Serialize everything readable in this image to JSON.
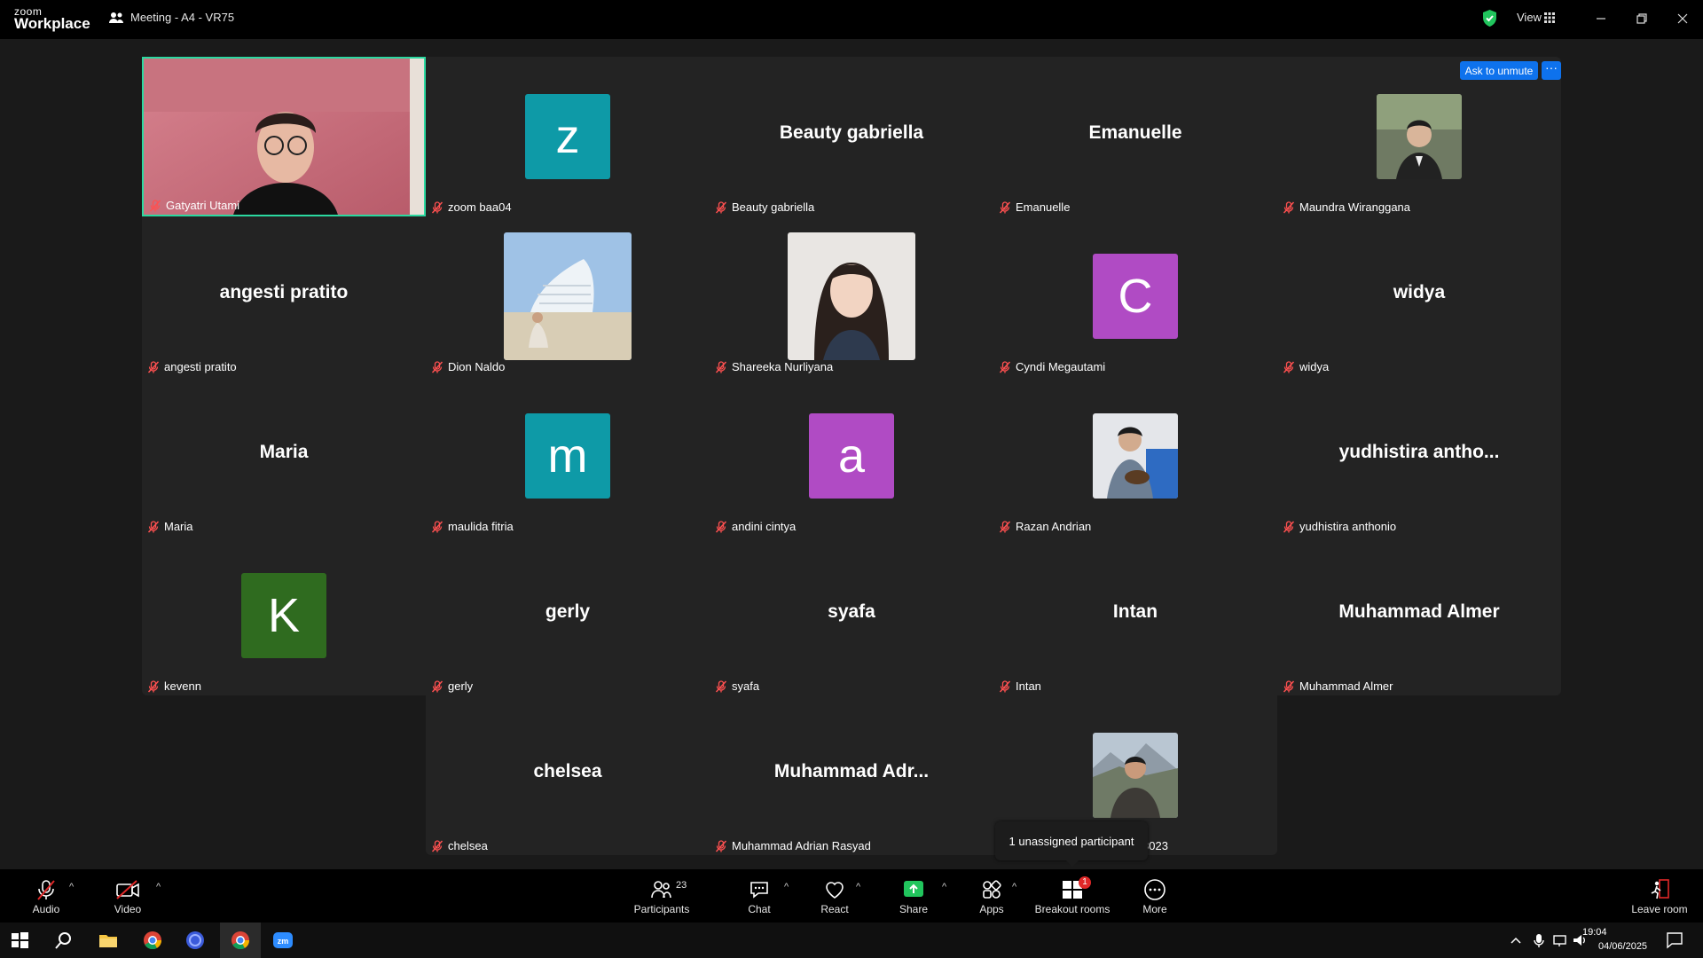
{
  "app": {
    "logo_top": "zoom",
    "logo_bottom": "Workplace",
    "meeting_title": "Meeting - A4 - VR75",
    "view_label": "View"
  },
  "actions": {
    "ask_to_unmute": "Ask to unmute",
    "more_dots": "···"
  },
  "tiles": [
    {
      "name": "Gatyatri Utami"
    },
    {
      "name": "zoom baa04",
      "initial": "z",
      "color": "#0e9aa7"
    },
    {
      "name": "Beauty gabriella",
      "big": "Beauty gabriella"
    },
    {
      "name": "Emanuelle",
      "big": "Emanuelle"
    },
    {
      "name": "Maundra Wiranggana"
    },
    {
      "name": "angesti pratito",
      "big": "angesti pratito"
    },
    {
      "name": "Dion Naldo"
    },
    {
      "name": "Shareeka Nurliyana"
    },
    {
      "name": "Cyndi Megautami",
      "initial": "C",
      "color": "#b04bc4"
    },
    {
      "name": "widya",
      "big": "widya"
    },
    {
      "name": "Maria",
      "big": "Maria"
    },
    {
      "name": "maulida fitria",
      "initial": "m",
      "color": "#0e9aa7"
    },
    {
      "name": "andini cintya",
      "initial": "a",
      "color": "#b04bc4"
    },
    {
      "name": "Razan Andrian"
    },
    {
      "name": "yudhistira anthonio",
      "big": "yudhistira antho..."
    },
    {
      "name": "kevenn",
      "initial": "K",
      "color": "#2f6b1f"
    },
    {
      "name": "gerly",
      "big": "gerly"
    },
    {
      "name": "syafa",
      "big": "syafa"
    },
    {
      "name": "Intan",
      "big": "Intan"
    },
    {
      "name": "Muhammad Almer",
      "big": "Muhammad Almer"
    },
    {
      "name": "chelsea",
      "big": "chelsea"
    },
    {
      "name": "Muhammad Adrian Rasyad",
      "big": "Muhammad Adr..."
    },
    {
      "name": "3023"
    }
  ],
  "tooltip": {
    "text": "1 unassigned participant"
  },
  "toolbar": {
    "audio": "Audio",
    "video": "Video",
    "participants": "Participants",
    "participants_count": "23",
    "chat": "Chat",
    "react": "React",
    "share": "Share",
    "apps": "Apps",
    "breakout": "Breakout rooms",
    "breakout_badge": "1",
    "more": "More",
    "leave": "Leave room"
  },
  "taskbar": {
    "time": "19:04",
    "date": "04/06/2025"
  },
  "colors": {
    "highlight_border": "#2bd9a0",
    "accent_blue": "#0e72ed",
    "share_green": "#21c55d",
    "muted_red": "#e02828"
  }
}
